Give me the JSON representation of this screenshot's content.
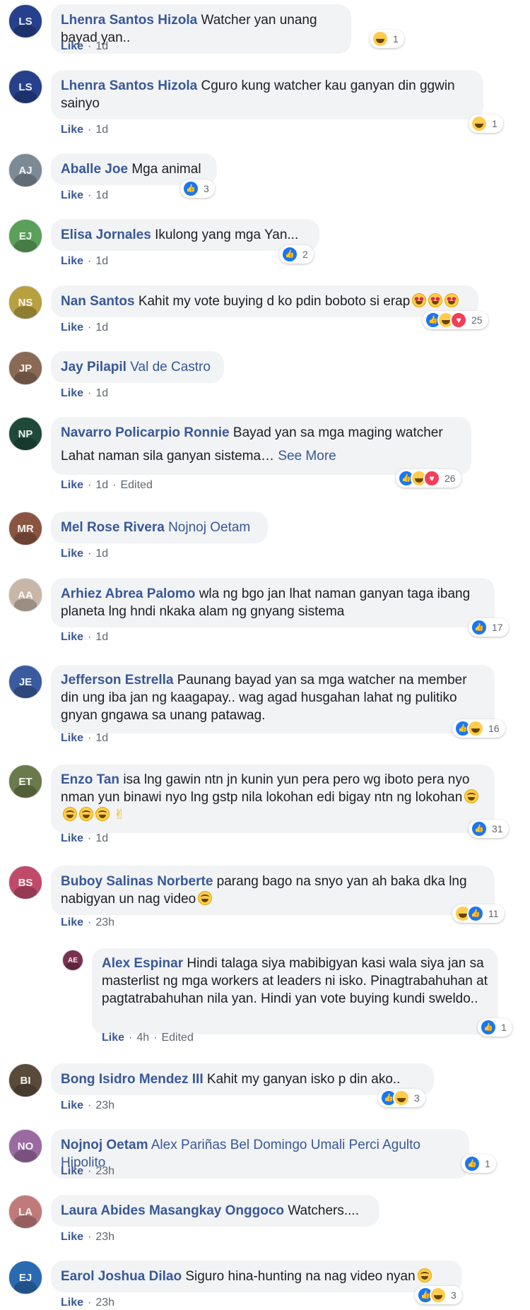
{
  "like_label": "Like",
  "see_more_label": "See More",
  "comments": [
    {
      "author": "Lhenra Santos Hizola",
      "text": "Watcher yan unang bayad yan..",
      "time": "1d",
      "reactions": [
        "haha"
      ],
      "count": "1",
      "avatar_color": "#26408b"
    },
    {
      "author": "Lhenra Santos Hizola",
      "text": "Cguro kung watcher kau ganyan din ggwin sainyo",
      "time": "1d",
      "reactions": [
        "haha"
      ],
      "count": "1",
      "avatar_color": "#26408b"
    },
    {
      "author": "Aballe Joe",
      "text": "Mga animal",
      "time": "1d",
      "reactions": [
        "like"
      ],
      "count": "3",
      "avatar_color": "#7c8a96"
    },
    {
      "author": "Elisa Jornales",
      "text": "Ikulong yang mga Yan...",
      "time": "1d",
      "reactions": [
        "like"
      ],
      "count": "2",
      "avatar_color": "#5aa05a"
    },
    {
      "author": "Nan Santos",
      "text": "Kahit my vote buying d ko pdin boboto si erap",
      "emoji": [
        "hearteyes",
        "hearteyes",
        "hearteyes"
      ],
      "time": "1d",
      "reactions": [
        "like",
        "haha",
        "love"
      ],
      "count": "25",
      "avatar_color": "#b8a040"
    },
    {
      "author": "Jay Pilapil",
      "mention": "Val de Castro",
      "time": "1d",
      "avatar_color": "#8a6a55"
    },
    {
      "author": "Navarro Policarpio Ronnie",
      "text": "Bayad yan sa mga maging watcher",
      "text2": "Lahat naman sila ganyan sistema…",
      "see_more": true,
      "time": "1d",
      "edited": "Edited",
      "reactions": [
        "like",
        "haha",
        "love"
      ],
      "count": "26",
      "avatar_color": "#1f4a3a"
    },
    {
      "author": "Mel Rose Rivera",
      "mention": "Nojnoj Oetam",
      "time": "1d",
      "avatar_color": "#8a5540"
    },
    {
      "author": "Arhiez Abrea Palomo",
      "text": "wla ng bgo jan lhat naman ganyan taga ibang planeta lng hndi nkaka alam ng gnyang sistema",
      "time": "1d",
      "reactions": [
        "like"
      ],
      "count": "17",
      "avatar_color": "#c9b6a8"
    },
    {
      "author": "Jefferson Estrella",
      "text": "Paunang bayad yan sa mga watcher na member din ung iba jan ng kaagapay.. wag agad husgahan lahat ng pulitiko gnyan gngawa sa unang patawag.",
      "time": "1d",
      "reactions": [
        "like",
        "haha"
      ],
      "count": "16",
      "avatar_color": "#3a5ba0"
    },
    {
      "author": "Enzo Tan",
      "text": "isa lng gawin ntn jn kunin yun pera pero wg iboto pera nyo nman yun binawi nyo lng gstp nila lokohan edi bigay ntn ng lokohan",
      "emoji": [
        "tears"
      ],
      "emoji2": [
        "tears",
        "tears",
        "tears"
      ],
      "peace": "✌",
      "time": "1d",
      "reactions": [
        "like"
      ],
      "count": "31",
      "avatar_color": "#6a7a4a"
    },
    {
      "author": "Buboy Salinas Norberte",
      "text": "parang bago na snyo yan ah baka dka lng nabigyan un nag video",
      "emoji": [
        "tears"
      ],
      "time": "23h",
      "reactions": [
        "haha",
        "like"
      ],
      "count": "11",
      "avatar_color": "#c04a6a"
    },
    {
      "author": "Alex Espinar",
      "text": "Hindi talaga siya mabibigyan kasi wala siya jan sa masterlist ng mga workers at leaders ni isko. Pinagtrabahuhan at pagtatrabahuhan nila yan. Hindi yan vote buying kundi sweldo..",
      "time": "4h",
      "edited": "Edited",
      "reactions": [
        "like"
      ],
      "count": "1",
      "avatar_color": "#7a3050"
    },
    {
      "author": "Bong Isidro Mendez III",
      "text": "Kahit my ganyan isko p din ako..",
      "time": "23h",
      "reactions": [
        "like",
        "haha"
      ],
      "count": "3",
      "avatar_color": "#5a4a3a"
    },
    {
      "author": "Nojnoj Oetam",
      "mention": "Alex Pariñas Bel Domingo Umali Perci Agulto Hipolito",
      "time": "23h",
      "reactions": [
        "like"
      ],
      "count": "1",
      "avatar_color": "#9a6aa0"
    },
    {
      "author": "Laura Abides Masangkay Onggoco",
      "text": "Watchers....",
      "time": "23h",
      "avatar_color": "#c07a7a"
    },
    {
      "author": "Earol Joshua Dilao",
      "text": "Siguro hina-hunting na nag video nyan",
      "emoji": [
        "haha"
      ],
      "time": "23h",
      "reactions": [
        "like",
        "haha"
      ],
      "count": "3",
      "avatar_color": "#2a6ab0"
    }
  ]
}
